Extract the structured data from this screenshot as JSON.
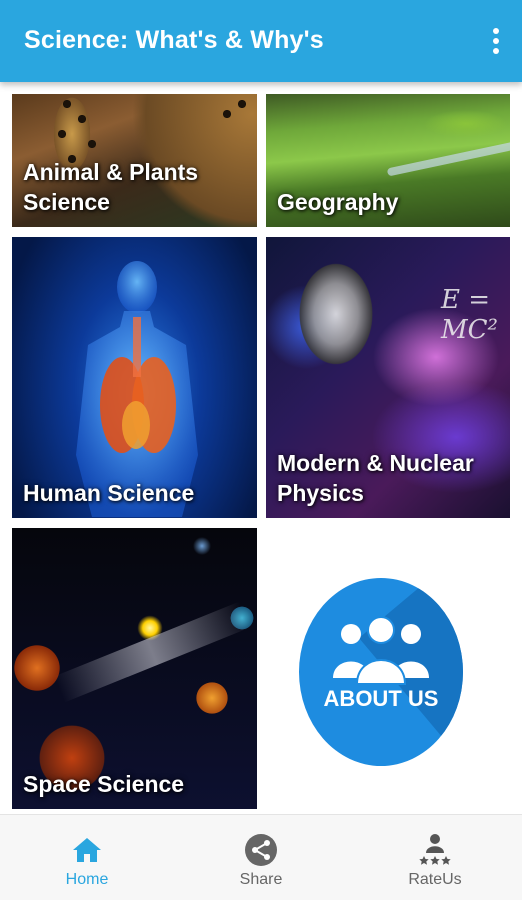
{
  "appbar": {
    "title": "Science: What's & Why's",
    "menu_icon": "overflow-menu-icon"
  },
  "tiles": [
    {
      "label": "Animal & Plants Science"
    },
    {
      "label": "Geography"
    },
    {
      "label": "Human Science"
    },
    {
      "label": "Modern & Nuclear Physics",
      "formula": "E = MC²"
    },
    {
      "label": "Space Science"
    }
  ],
  "about": {
    "label": "ABOUT US",
    "icon": "people-group-icon"
  },
  "bottom_nav": {
    "items": [
      {
        "label": "Home",
        "icon": "home-icon",
        "active": true
      },
      {
        "label": "Share",
        "icon": "share-icon",
        "active": false
      },
      {
        "label": "RateUs",
        "icon": "rate-us-icon",
        "active": false
      }
    ]
  },
  "colors": {
    "primary": "#2aa6df",
    "active_nav": "#2aa6df",
    "inactive_nav": "#666666",
    "about_badge": "#1e8ce0"
  }
}
